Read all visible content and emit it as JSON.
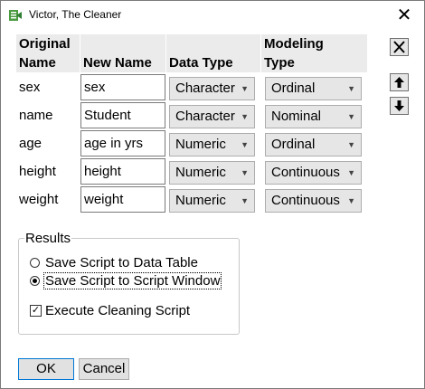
{
  "window": {
    "title": "Victor, The Cleaner",
    "close_glyph": "✕"
  },
  "table": {
    "headers": {
      "original_name": [
        "Original",
        "Name"
      ],
      "new_name": [
        "",
        "New Name"
      ],
      "data_type": [
        "",
        "Data Type"
      ],
      "modeling_type": [
        "Modeling",
        "Type"
      ]
    },
    "rows": [
      {
        "original": "sex",
        "new_name": "sex",
        "data_type": "Character",
        "modeling_type": "Ordinal"
      },
      {
        "original": "name",
        "new_name": "Student",
        "data_type": "Character",
        "modeling_type": "Nominal"
      },
      {
        "original": "age",
        "new_name": "age in yrs",
        "data_type": "Numeric",
        "modeling_type": "Ordinal"
      },
      {
        "original": "height",
        "new_name": "height",
        "data_type": "Numeric",
        "modeling_type": "Continuous"
      },
      {
        "original": "weight",
        "new_name": "weight",
        "data_type": "Numeric",
        "modeling_type": "Continuous"
      }
    ]
  },
  "side_buttons": {
    "delete": "close-x-icon",
    "up": "arrow-up-icon",
    "down": "arrow-down-icon"
  },
  "results": {
    "legend": "Results",
    "options": [
      {
        "label": "Save Script to Data Table",
        "checked": false
      },
      {
        "label": "Save Script to Script Window",
        "checked": true
      }
    ],
    "execute_label": "Execute Cleaning Script",
    "execute_checked": true,
    "check_glyph": "✓"
  },
  "buttons": {
    "ok": "OK",
    "cancel": "Cancel"
  },
  "colors": {
    "header_bg": "#ebebeb",
    "combo_bg": "#e6e6e6",
    "focus_border": "#0078d7"
  }
}
